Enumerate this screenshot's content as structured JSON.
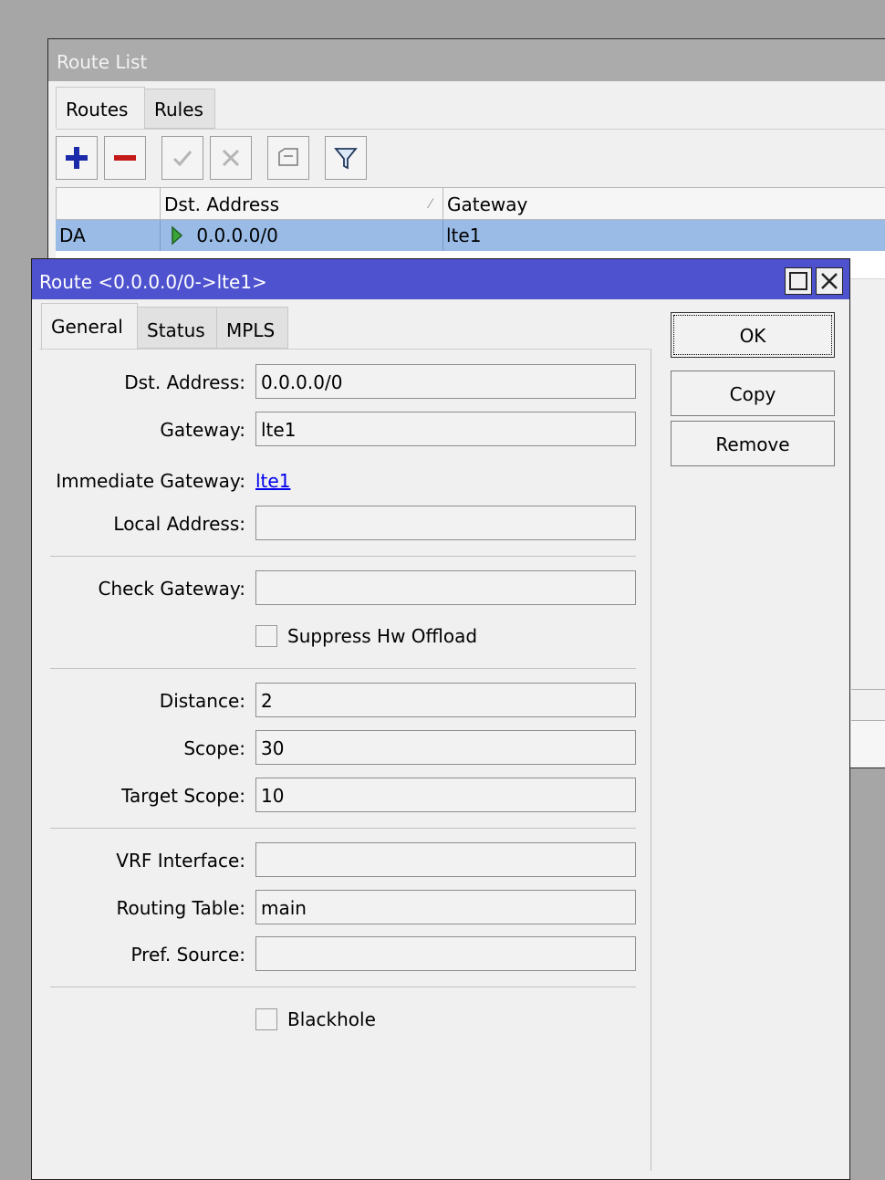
{
  "route_list": {
    "title": "Route List",
    "tabs": [
      {
        "label": "Routes"
      },
      {
        "label": "Rules"
      }
    ],
    "columns": {
      "flags": "",
      "dst_address": "Dst. Address",
      "gateway": "Gateway"
    },
    "rows": [
      {
        "flags": "DA",
        "dst_address": "0.0.0.0/0",
        "gateway": "lte1"
      }
    ],
    "toolbar": [
      "add-icon",
      "remove-icon",
      "enable-icon",
      "disable-icon",
      "comment-icon",
      "filter-icon"
    ]
  },
  "dialog": {
    "title": "Route <0.0.0.0/0->lte1>",
    "tabs": [
      {
        "label": "General"
      },
      {
        "label": "Status"
      },
      {
        "label": "MPLS"
      }
    ],
    "buttons": {
      "ok": "OK",
      "copy": "Copy",
      "remove": "Remove"
    },
    "fields": {
      "dst_address": {
        "label": "Dst. Address:",
        "value": "0.0.0.0/0"
      },
      "gateway": {
        "label": "Gateway:",
        "value": "lte1"
      },
      "immediate_gateway": {
        "label": "Immediate Gateway:",
        "value": "lte1"
      },
      "local_address": {
        "label": "Local Address:",
        "value": ""
      },
      "check_gateway": {
        "label": "Check Gateway:",
        "value": ""
      },
      "suppress_hw_offload": {
        "label": "Suppress Hw Offload",
        "checked": false
      },
      "distance": {
        "label": "Distance:",
        "value": "2"
      },
      "scope": {
        "label": "Scope:",
        "value": "30"
      },
      "target_scope": {
        "label": "Target Scope:",
        "value": "10"
      },
      "vrf_interface": {
        "label": "VRF Interface:",
        "value": ""
      },
      "routing_table": {
        "label": "Routing Table:",
        "value": "main"
      },
      "pref_source": {
        "label": "Pref. Source:",
        "value": ""
      },
      "blackhole": {
        "label": "Blackhole",
        "checked": false
      }
    }
  },
  "colors": {
    "dialog_title_bg": "#4e52cf",
    "selected_row_bg": "#99bbe6",
    "list_title_bg": "#ababab"
  }
}
